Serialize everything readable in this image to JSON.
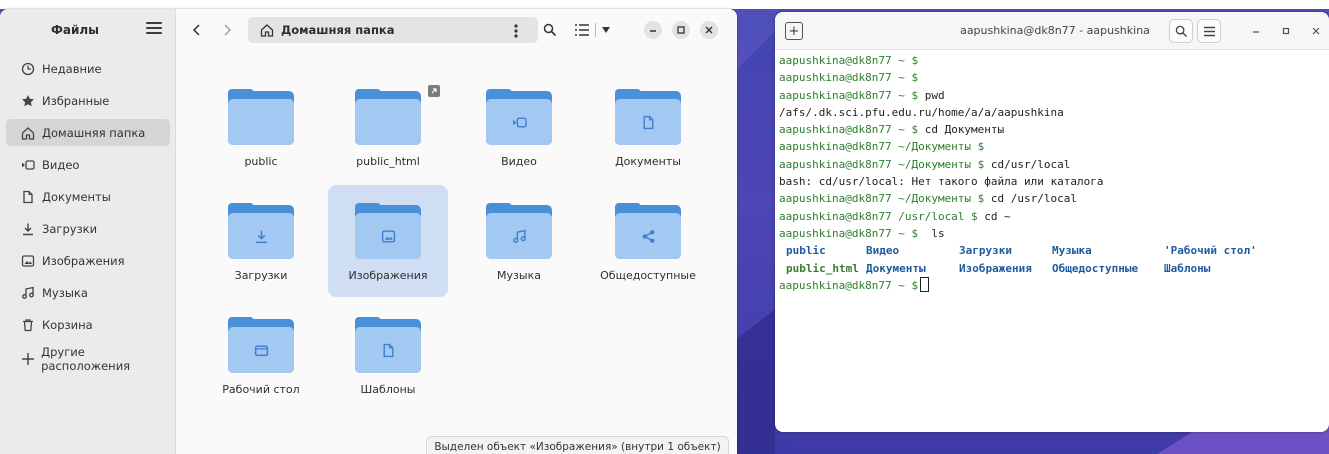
{
  "files": {
    "sidebar": {
      "title": "Файлы",
      "items": [
        {
          "label": "Недавние",
          "icon": "clock-icon",
          "active": false
        },
        {
          "label": "Избранные",
          "icon": "star-icon",
          "active": false
        },
        {
          "label": "Домашняя папка",
          "icon": "home-icon",
          "active": true
        },
        {
          "label": "Видео",
          "icon": "video-icon",
          "active": false
        },
        {
          "label": "Документы",
          "icon": "document-icon",
          "active": false
        },
        {
          "label": "Загрузки",
          "icon": "download-icon",
          "active": false
        },
        {
          "label": "Изображения",
          "icon": "image-icon",
          "active": false
        },
        {
          "label": "Музыка",
          "icon": "music-icon",
          "active": false
        },
        {
          "label": "Корзина",
          "icon": "trash-icon",
          "active": false
        }
      ],
      "other_locations": {
        "label": "Другие расположения",
        "icon": "plus-icon"
      }
    },
    "header": {
      "path": "Домашняя папка",
      "path_icon": "home-icon"
    },
    "folders": [
      {
        "name": "public",
        "emblem": "",
        "selected": false
      },
      {
        "name": "public_html",
        "emblem": "",
        "selected": false,
        "link": true
      },
      {
        "name": "Видео",
        "emblem": "video-icon",
        "selected": false
      },
      {
        "name": "Документы",
        "emblem": "document-icon",
        "selected": false
      },
      {
        "name": "Загрузки",
        "emblem": "download-icon",
        "selected": false
      },
      {
        "name": "Изображения",
        "emblem": "image-icon",
        "selected": true
      },
      {
        "name": "Музыка",
        "emblem": "music-icon",
        "selected": false
      },
      {
        "name": "Общедоступные",
        "emblem": "share-icon",
        "selected": false
      },
      {
        "name": "Рабочий стол",
        "emblem": "desktop-icon",
        "selected": false
      },
      {
        "name": "Шаблоны",
        "emblem": "document-icon",
        "selected": false
      }
    ],
    "status": "Выделен объект «Изображения» (внутри 1 объект)"
  },
  "terminal": {
    "title": "aapushkina@dk8n77 - aapushkina",
    "lines": [
      {
        "prompt": "aapushkina@dk8n77 ~ $",
        "cmd": ""
      },
      {
        "prompt": "aapushkina@dk8n77 ~ $",
        "cmd": ""
      },
      {
        "prompt": "aapushkina@dk8n77 ~ $",
        "cmd": " pwd"
      },
      {
        "prompt": "",
        "cmd": "/afs/.dk.sci.pfu.edu.ru/home/a/a/aapushkina"
      },
      {
        "prompt": "aapushkina@dk8n77 ~ $",
        "cmd": " cd Документы"
      },
      {
        "prompt": "aapushkina@dk8n77 ~/Документы $",
        "cmd": ""
      },
      {
        "prompt": "aapushkina@dk8n77 ~/Документы $",
        "cmd": " cd/usr/local"
      },
      {
        "prompt": "",
        "cmd": "bash: cd/usr/local: Нет такого файла или каталога"
      },
      {
        "prompt": "aapushkina@dk8n77 ~/Документы $",
        "cmd": " cd /usr/local"
      },
      {
        "prompt": "aapushkina@dk8n77 /usr/local $",
        "cmd": " cd ~"
      },
      {
        "prompt": "aapushkina@dk8n77 ~ $",
        "cmd": "  ls"
      }
    ],
    "ls_rows": [
      [
        {
          "text": "public",
          "color": "blue"
        },
        {
          "text": "Видео",
          "color": "blue"
        },
        {
          "text": "Загрузки",
          "color": "blue"
        },
        {
          "text": "Музыка",
          "color": "blue"
        },
        {
          "text": "'Рабочий стол'",
          "color": "blue"
        }
      ],
      [
        {
          "text": "public_html",
          "color": "green"
        },
        {
          "text": "Документы",
          "color": "blue"
        },
        {
          "text": "Изображения",
          "color": "blue"
        },
        {
          "text": "Общедоступные",
          "color": "blue"
        },
        {
          "text": "Шаблоны",
          "color": "blue"
        }
      ]
    ],
    "final_prompt": "aapushkina@dk8n77 ~ $",
    "colors": {
      "prompt": "#2d7d2d",
      "dir_blue": "#1f5a9e",
      "dir_green": "#3f7a2f"
    }
  },
  "theme": {
    "accent": "#4a90d9",
    "folder_front": "#a3c8f1",
    "selection": "#cfdef3"
  }
}
